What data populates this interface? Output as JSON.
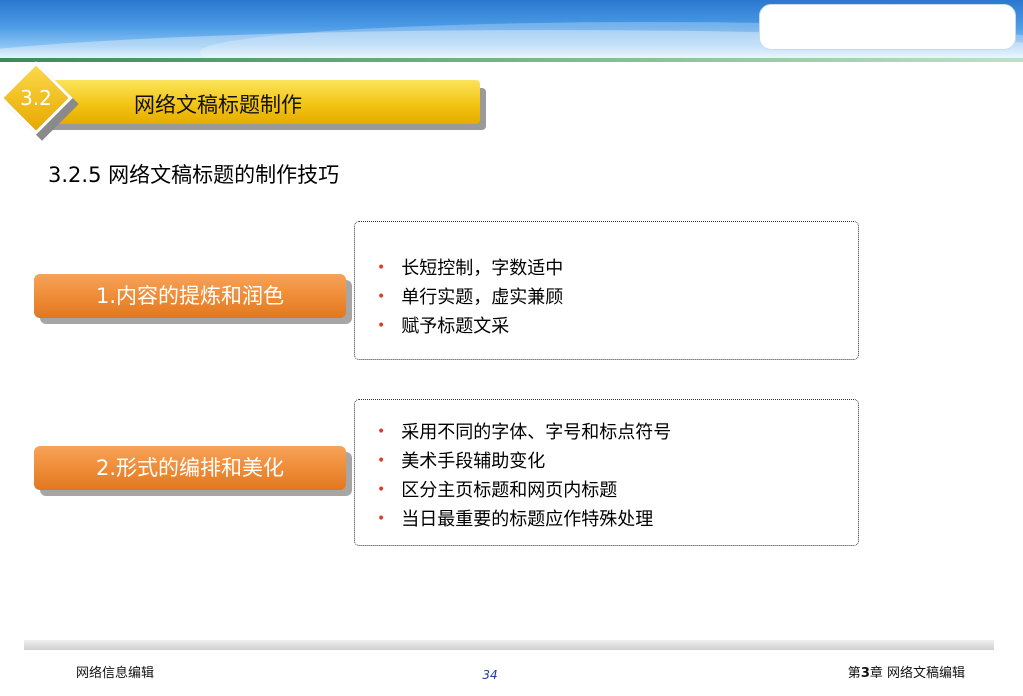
{
  "section": {
    "number": "3.2",
    "title": "网络文稿标题制作"
  },
  "subheading": "3.2.5 网络文稿标题的制作技巧",
  "groups": [
    {
      "label": "1.内容的提炼和润色",
      "items": [
        "长短控制，字数适中",
        "单行实题，虚实兼顾",
        "赋予标题文采"
      ]
    },
    {
      "label": "2.形式的编排和美化",
      "items": [
        "采用不同的字体、字号和标点符号",
        "美术手段辅助变化",
        "区分主页标题和网页内标题",
        "当日最重要的标题应作特殊处理"
      ]
    }
  ],
  "footer": {
    "left": "网络信息编辑",
    "page": "34",
    "right_prefix": "第",
    "right_num": "3",
    "right_suffix": "章 网络文稿编辑"
  },
  "colors": {
    "accent_yellow": "#f2c20f",
    "accent_orange": "#ee8a35",
    "bullet_red": "#e23b2a",
    "banner_blue": "#2a78cf"
  }
}
